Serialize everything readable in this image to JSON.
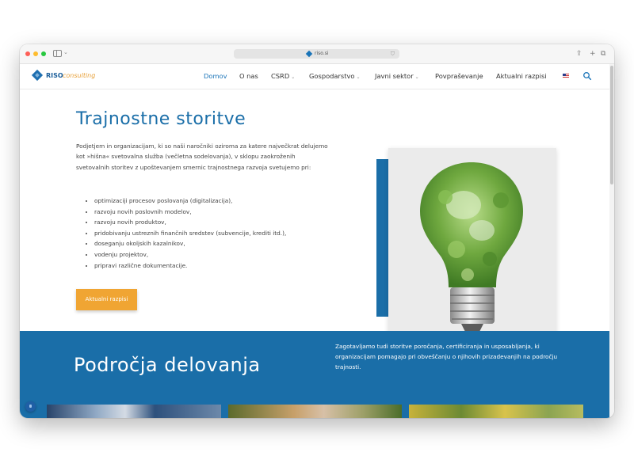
{
  "browser": {
    "url": "riso.si"
  },
  "logo": {
    "brand": "RISO",
    "suffix": "consulting"
  },
  "nav": {
    "items": [
      {
        "label": "Domov",
        "active": true
      },
      {
        "label": "O nas"
      },
      {
        "label": "CSRD",
        "dropdown": true
      },
      {
        "label": "Gospodarstvo",
        "dropdown": true
      },
      {
        "label": "Javni sektor",
        "dropdown": true
      },
      {
        "label": "Povpraševanje"
      },
      {
        "label": "Aktualni razpisi"
      }
    ],
    "language_icon": "us-flag-icon",
    "search_icon": "search-icon"
  },
  "hero": {
    "title": "Trajnostne storitve",
    "intro": "Podjetjem in organizacijam, ki so naši naročniki oziroma za katere največkrat delujemo kot »hišna« svetovalna služba (večletna sodelovanja), v sklopu zaokroženih svetovalnih storitev z upoštevanjem smernic trajnostnega razvoja svetujemo pri:",
    "list": [
      "optimizaciji procesov poslovanja (digitalizacija),",
      "razvoju novih poslovnih modelov,",
      "razvoju novih produktov,",
      "pridobivanju ustreznih finančnih sredstev (subvencije, krediti itd.),",
      "doseganju okoljskih kazalnikov,",
      "vodenju projektov,",
      "pripravi različne dokumentacije."
    ],
    "cta": "Aktualni razpisi"
  },
  "section": {
    "title": "Področja delovanja",
    "text": "Zagotavljamo tudi storitve poročanja, certificiranja in usposabljanja, ki organizacijam pomagajo pri obveščanju o njihovih prizadevanjih na področju trajnosti."
  },
  "colors": {
    "brand_blue": "#1a6ea8",
    "cta_orange": "#f0a533",
    "nav_active": "#1a74b8"
  }
}
